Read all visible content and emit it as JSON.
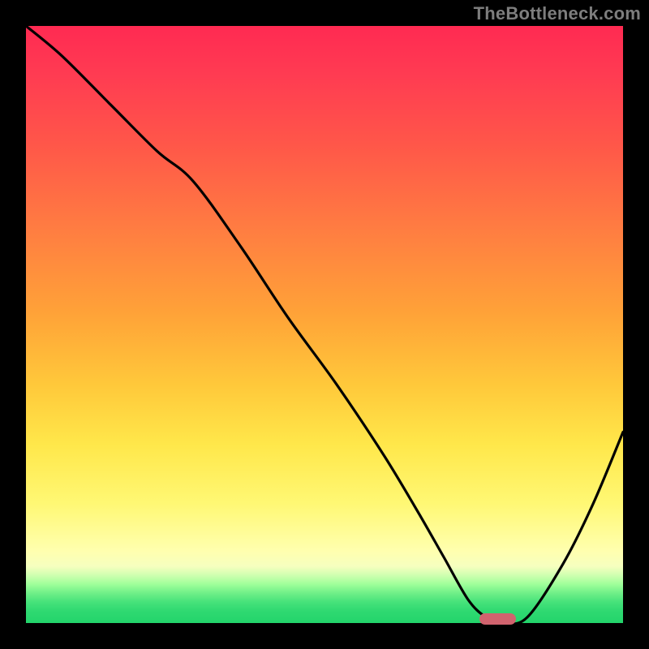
{
  "watermark": "TheBottleneck.com",
  "colors": {
    "marker": "#d1636e",
    "curve": "#000000"
  },
  "chart_data": {
    "type": "line",
    "title": "",
    "xlabel": "",
    "ylabel": "",
    "xlim": [
      0,
      100
    ],
    "ylim": [
      0,
      100
    ],
    "grid": false,
    "legend": false,
    "series": [
      {
        "name": "bottleneck-curve",
        "x": [
          0,
          6,
          14,
          22,
          28,
          36,
          44,
          52,
          60,
          66,
          70,
          74,
          77,
          80,
          84,
          90,
          95,
          100
        ],
        "y": [
          100,
          95,
          87,
          79,
          74,
          63,
          51,
          40,
          28,
          18,
          11,
          4,
          1,
          0,
          1,
          10,
          20,
          32
        ]
      }
    ],
    "marker": {
      "x": 79,
      "y": 0,
      "width_pct": 6
    },
    "note": "Y is plotted inverted (0 at bottom). Values are visual estimates from pixels; no axis labels present."
  }
}
